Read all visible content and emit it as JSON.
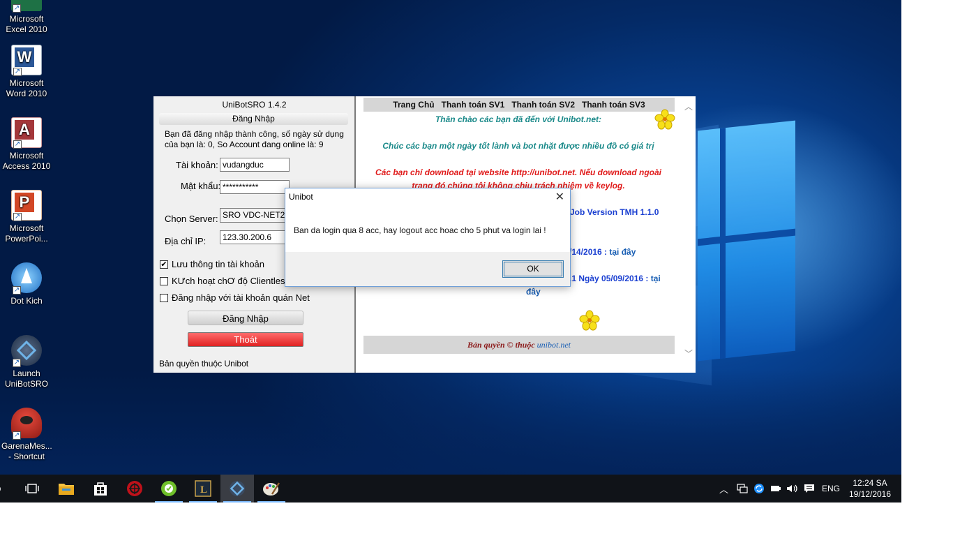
{
  "desktop": {
    "icons": [
      {
        "label": "Microsoft\nExcel 2010",
        "icon": "excel-icon",
        "color": "#1e7145"
      },
      {
        "label": "Microsoft\nWord 2010",
        "icon": "word-icon",
        "color": "#2b5797"
      },
      {
        "label": "Microsoft\nAccess 2010",
        "icon": "access-icon",
        "color": "#a4373a"
      },
      {
        "label": "Microsoft\nPowerPoi...",
        "icon": "powerpoint-icon",
        "color": "#d24726"
      },
      {
        "label": "Dot Kich",
        "icon": "dotkich-icon",
        "color": "#3a8fd6"
      },
      {
        "label": "Launch\nUniBotSRO",
        "icon": "unibot-icon",
        "color": "#2a3b55"
      },
      {
        "label": "GarenaMes...\n- Shortcut",
        "icon": "garena-icon",
        "color": "#c0392b"
      }
    ]
  },
  "unibot": {
    "title": "UniBotSRO 1.4.2",
    "section_header": "Đăng Nhập",
    "login_message": "Bạn đã đăng nhập thành công, số ngày sử dụng của bạn là: 0, So Account đang online là: 9",
    "username_label": "Tài khoản:",
    "username_value": "vudangduc",
    "password_label": "Mật khẩu:",
    "password_value": "***********",
    "server_label": "Chọn Server:",
    "server_value": "SRO VDC-NET2",
    "ip_label": "Địa chỉ IP:",
    "ip_value": "123.30.200.6",
    "checkboxes": [
      {
        "label": "Lưu thông tin tài khoản",
        "checked": "✔"
      },
      {
        "label": "KƯch hoạt chƠ độ Clientless",
        "checked": ""
      },
      {
        "label": "Đăng nhập với tài khoản quán Net",
        "checked": ""
      }
    ],
    "login_button": "Đăng Nhập",
    "exit_button": "Thoát",
    "copyright": "Bản quyền thuộc Unibot"
  },
  "web": {
    "nav": [
      "Trang Chủ",
      "Thanh toán SV1",
      "Thanh toán SV2",
      "Thanh toán SV3"
    ],
    "greeting": "Thân chào các bạn đã đến với Unibot.net:",
    "wish": "Chúc các bạn một ngày tốt lành và bot nhặt được nhiều đồ có giá trị",
    "warning_1": "Các bạn chỉ download tại website http://unibot.net. Nếu download ngoài",
    "warning_2": "trang đó chúng tôi không chịu trách nhiệm về keylog.",
    "job_version": "Job Version TMH 1.1.0",
    "update_1_date": "/14/2016 :",
    "update_1_link": "tại đây",
    "update_2_date": ".1 Ngày 05/09/2016 :",
    "update_2_link_a": "tại",
    "update_2_link_b": "đây",
    "footer_text": "Bản quyền © thuộc",
    "footer_link": "unibot.net",
    "colors": {
      "teal": "#1b8a8a",
      "red": "#e01b1b",
      "blue": "#1a3fd1",
      "link": "#1a5fb4"
    }
  },
  "dialog": {
    "title": "Unibot",
    "message": "Ban da login qua 8 acc, hay logout acc hoac cho 5 phut va login lai !",
    "ok_label": "OK",
    "close_glyph": "✕"
  },
  "taskbar": {
    "search_glyph": "○",
    "apps": [
      "taskview-icon",
      "file-explorer-icon",
      "store-icon",
      "app-red-icon",
      "app-green-icon",
      "league-icon",
      "unibot-icon",
      "paint-icon"
    ],
    "language": "ENG",
    "time": "12:24 SA",
    "date": "19/12/2016"
  }
}
